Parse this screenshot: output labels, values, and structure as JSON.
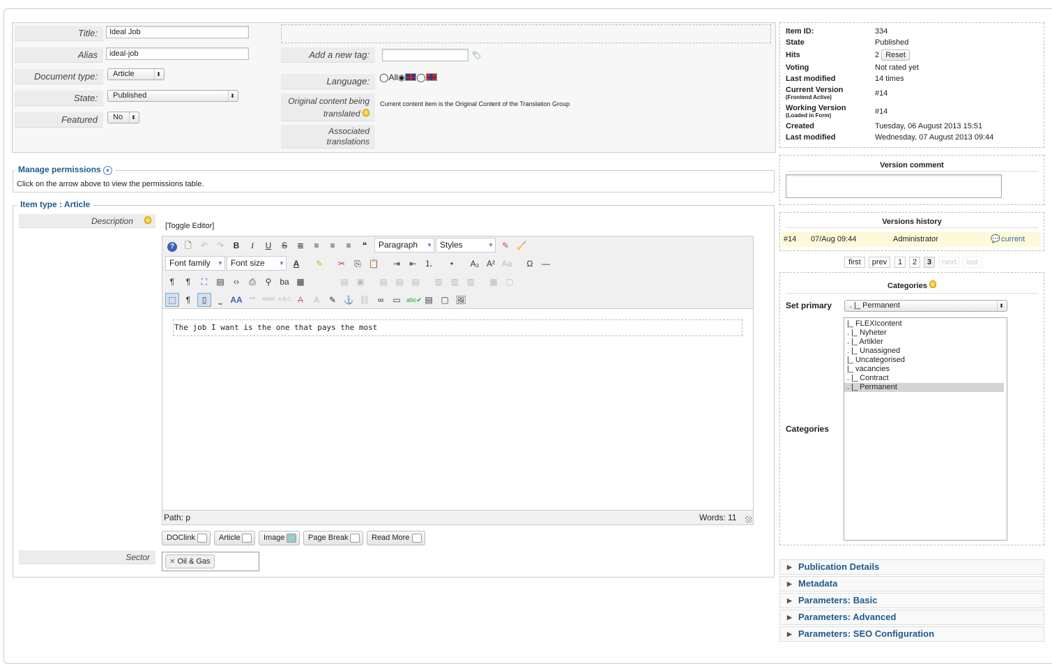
{
  "form": {
    "title_label": "Title:",
    "title_value": "Ideal Job",
    "alias_label": "Alias",
    "alias_value": "ideal-job",
    "doctype_label": "Document type:",
    "doctype_value": "Article",
    "state_label": "State:",
    "state_value": "Published",
    "featured_label": "Featured",
    "featured_value": "No"
  },
  "tags": {
    "add_label": "Add a new tag:",
    "language_label": "Language:",
    "language_all": "All",
    "original_label": "Original content being translated",
    "original_text": "Current content item is the Original Content of the Translation Group",
    "assoc_label": "Associated translations"
  },
  "permissions": {
    "title": "Manage permissions",
    "hint": "Click on the arrow above to view the permissions table."
  },
  "itemtype": {
    "title": "Item type : Article",
    "description_label": "Description",
    "toggle": "[Toggle Editor]",
    "sector_label": "Sector",
    "sector_tag": "Oil & Gas"
  },
  "editor": {
    "format_select": "Paragraph",
    "styles_select": "Styles",
    "font_family": "Font family",
    "font_size": "Font size",
    "content": "The job I want is the one that pays the most",
    "path": "Path:  p",
    "words": "Words: 11",
    "buttons": [
      "DOClink",
      "Article",
      "Image",
      "Page Break",
      "Read More"
    ]
  },
  "meta": {
    "rows": [
      {
        "k": "Item ID:",
        "v": "334"
      },
      {
        "k": "State",
        "v": "Published"
      },
      {
        "k": "Hits",
        "v": "2"
      },
      {
        "k": "Voting",
        "v": "Not rated yet"
      },
      {
        "k": "Last modified",
        "v": "14 times"
      },
      {
        "k": "Current Version",
        "sub": "(Frontend Active)",
        "v": "#14"
      },
      {
        "k": "Working Version",
        "sub": "(Loaded in Form)",
        "v": "#14"
      },
      {
        "k": "Created",
        "v": "Tuesday, 06 August 2013 15:51"
      },
      {
        "k": "Last modified",
        "v": "Wednesday, 07 August 2013 09:44"
      }
    ],
    "reset": "Reset"
  },
  "version": {
    "comment_title": "Version comment",
    "history_title": "Versions history",
    "row": {
      "num": "#14",
      "date": "07/Aug 09:44",
      "user": "Administrator",
      "status": "current"
    },
    "pages": [
      "first",
      "prev",
      "1",
      "2",
      "3",
      "next",
      "last"
    ]
  },
  "categories": {
    "title": "Categories",
    "set_primary": "Set primary",
    "primary_value": ". |_ Permanent",
    "label": "Categories",
    "items": [
      "|_ FLEXIcontent",
      ". |_ Nyheter",
      ". |_ Artikler",
      ". |_ Unassigned",
      "|_ Uncategorised",
      "|_ vacancies",
      ". |_ Contract",
      ". |_ Permanent"
    ]
  },
  "panels": [
    "Publication Details",
    "Metadata",
    "Parameters: Basic",
    "Parameters: Advanced",
    "Parameters: SEO Configuration"
  ],
  "colors": {
    "accent": "#1f5a8c",
    "highlight": "#fbfbd9"
  }
}
